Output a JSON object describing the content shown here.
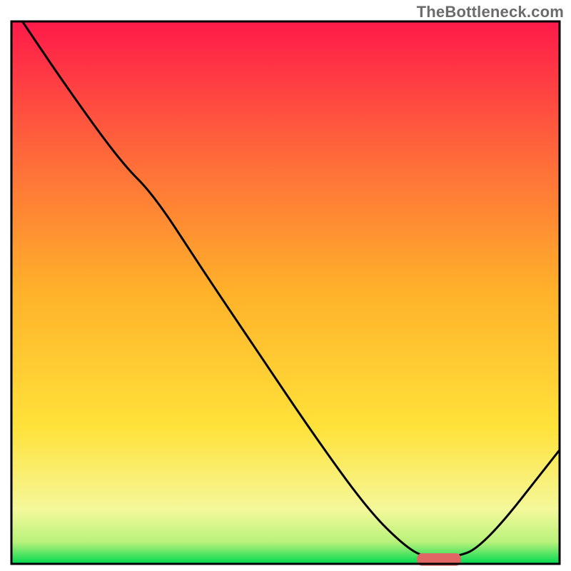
{
  "watermark": "TheBottleneck.com",
  "chart_data": {
    "type": "line",
    "title": "",
    "xlabel": "",
    "ylabel": "",
    "xlim": [
      0,
      100
    ],
    "ylim": [
      0,
      100
    ],
    "grid": false,
    "legend": false,
    "notes": "Single black performance/bottleneck curve over a vertical green-to-red heat gradient; a short red marker segment sits on the x-axis near the curve minimum.",
    "series": [
      {
        "name": "bottleneck-curve",
        "color": "#000000",
        "x": [
          2,
          10,
          20,
          26,
          35,
          45,
          55,
          65,
          72,
          76,
          80,
          86,
          100
        ],
        "y": [
          100,
          88,
          74,
          68,
          54,
          39,
          24,
          10,
          3,
          1,
          1,
          3,
          21
        ]
      }
    ],
    "marker": {
      "name": "optimal-range-marker",
      "color": "#e06666",
      "x_start": 74,
      "x_end": 82,
      "y": 0.8,
      "thickness": 2.3
    },
    "background_gradient": {
      "stops": [
        {
          "offset": 0,
          "color": "#00d850"
        },
        {
          "offset": 4,
          "color": "#b8f27a"
        },
        {
          "offset": 10,
          "color": "#f4f89a"
        },
        {
          "offset": 25,
          "color": "#ffe23a"
        },
        {
          "offset": 50,
          "color": "#ffb22a"
        },
        {
          "offset": 75,
          "color": "#ff6a3a"
        },
        {
          "offset": 100,
          "color": "#ff1a4a"
        }
      ]
    },
    "frame_color": "#000000"
  }
}
